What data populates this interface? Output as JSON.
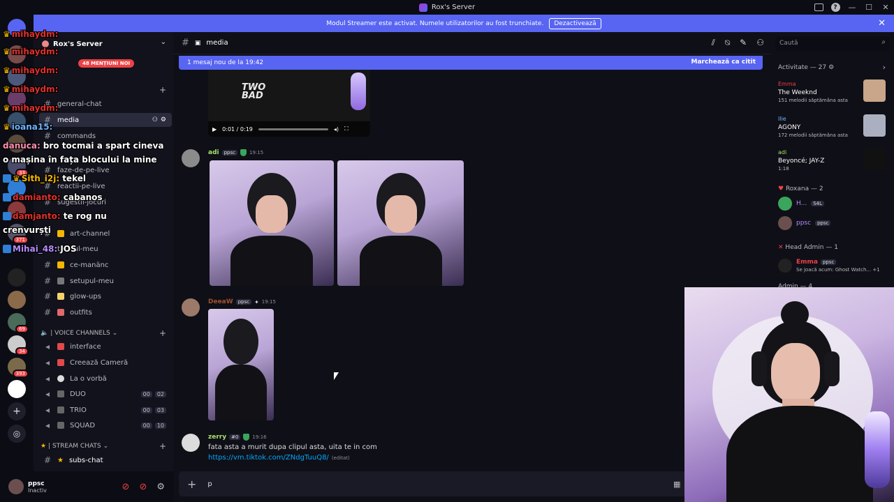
{
  "window": {
    "title": "Rox's Server"
  },
  "streamer_bar": {
    "text": "Modul Streamer este activat. Numele utilizatorilor au fost trunchiate.",
    "button": "Dezactivează"
  },
  "sidebar": {
    "server_name": "Rox's Server",
    "new_mentions": "48 MENȚIUNI NOI",
    "text_channels": [
      {
        "name": "general-chat"
      },
      {
        "name": "media"
      },
      {
        "name": "commands"
      },
      {
        "name": "faze-de-pe-live"
      },
      {
        "name": "reactii-pe-live"
      },
      {
        "name": "sugestii-jocuri"
      },
      {
        "name": "art-channel"
      },
      {
        "name": "tu-mul-meu"
      },
      {
        "name": "ce-manänc"
      },
      {
        "name": "setupul-meu"
      },
      {
        "name": "glow-ups"
      },
      {
        "name": "outfits"
      }
    ],
    "voice_category": "| VOICE CHANNELS",
    "voice_channels": [
      {
        "name": "interface"
      },
      {
        "name": "Creează Cameră"
      },
      {
        "name": "La o vorbă"
      },
      {
        "name": "DUO",
        "count_a": "00",
        "count_b": "02"
      },
      {
        "name": "TRIO",
        "count_a": "00",
        "count_b": "03"
      },
      {
        "name": "SQUAD",
        "count_a": "00",
        "count_b": "10"
      }
    ],
    "stream_category": "| STREAM CHATS",
    "stream_channels": [
      {
        "name": "subs-chat"
      }
    ]
  },
  "rail_badges": [
    "33",
    "371",
    "69",
    "34",
    "393"
  ],
  "overlay_chat": [
    {
      "user": "mihaydm:",
      "msg": ""
    },
    {
      "user": "mihaydm:",
      "msg": ""
    },
    {
      "user": "mihaydm:",
      "msg": ""
    },
    {
      "user": "mihaydm:",
      "msg": ""
    },
    {
      "user": "mihaydm:",
      "msg": ""
    },
    {
      "user": "ioana15:",
      "msg": ""
    },
    {
      "user": "danuca:",
      "msg": "bro tocmai a spart cineva"
    },
    {
      "user": "",
      "msg": "o mașina în fața blocului la mine"
    },
    {
      "user": "Sith_i2j:",
      "msg": "tekel"
    },
    {
      "user": "damianto:",
      "msg": "cabanos"
    },
    {
      "user": "damjanto:",
      "msg": "te rog nu"
    },
    {
      "user": "",
      "msg": "crenvurști"
    },
    {
      "user": "Mihai_48:",
      "msg": "JOS"
    }
  ],
  "user_panel": {
    "name": "ppsc",
    "status": "Inactiv"
  },
  "header": {
    "channel": "media"
  },
  "search": {
    "placeholder": "Caută"
  },
  "new_messages": {
    "text": "1 mesaj nou de la 19:42",
    "action": "Marchează ca citit"
  },
  "video": {
    "watermark_1": "TWO",
    "watermark_2": "BAD",
    "time": "0:01 / 0:19"
  },
  "messages": [
    {
      "user": "adi",
      "tag": "ppsc",
      "time": "19:15"
    },
    {
      "user": "DeeaW",
      "tag": "ppsc",
      "time": "19:15"
    },
    {
      "user": "zerry",
      "tag": "#0",
      "time": "19:16",
      "text": "fata asta a murit dupa clipul asta, uita te in com",
      "link": "https://vm.tiktok.com/ZNdgTuuQ8/",
      "edited": "(editat)"
    }
  ],
  "composer": {
    "value": "p"
  },
  "members": {
    "activity_title": "Activitate — 27",
    "activities": [
      {
        "user": "Emma",
        "song": "The Weeknd",
        "sub": "151 melodii săptămâna asta"
      },
      {
        "user": "Ilie",
        "song": "AGONY",
        "sub": "172 melodii săptămâna asta"
      },
      {
        "user": "adi",
        "song": "Beyoncé; JAY-Z",
        "sub": "1:18"
      }
    ],
    "roxana_title": "Roxana — 2",
    "roxana": [
      {
        "name": "H...",
        "sub": "S4L"
      },
      {
        "name": "ppsc",
        "sub": "ppsc"
      }
    ],
    "head_admin_title": "Head Admin — 1",
    "head_admin": [
      {
        "name": "Emma",
        "tag": "ppsc",
        "sub": "Se joacă acum: Ghost Watch... +1"
      }
    ],
    "admin_title": "Admin — 4"
  },
  "colors": {
    "accent": "#5865f2",
    "mention": "#ed4245",
    "link": "#00a8fc",
    "online": "#3ba55d"
  }
}
